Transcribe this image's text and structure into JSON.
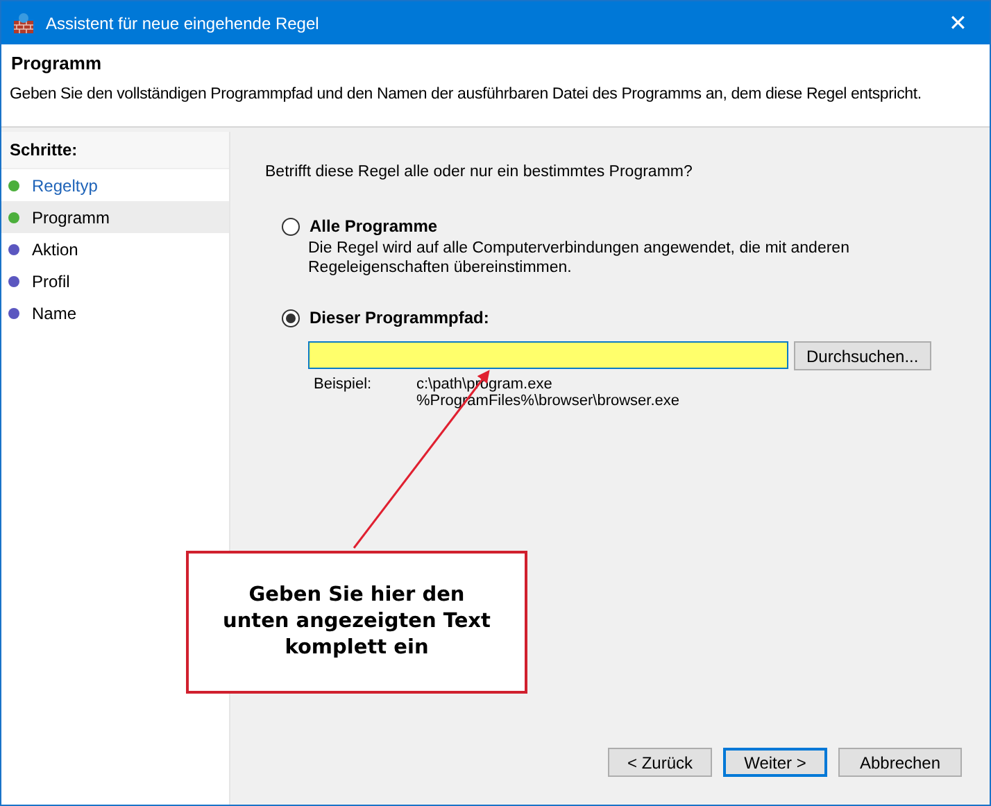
{
  "window": {
    "title": "Assistent für neue eingehende Regel",
    "close": "✕"
  },
  "header": {
    "title": "Programm",
    "description": "Geben Sie den vollständigen Programmpfad und den Namen der ausführbaren Datei des Programms an, dem diese Regel entspricht."
  },
  "steps": {
    "title": "Schritte:",
    "items": [
      {
        "label": "Regeltyp",
        "color": "#4caf3c",
        "selected": false,
        "link": true
      },
      {
        "label": "Programm",
        "color": "#4caf3c",
        "selected": true,
        "link": false
      },
      {
        "label": "Aktion",
        "color": "#5b57c0",
        "selected": false,
        "link": false
      },
      {
        "label": "Profil",
        "color": "#5b57c0",
        "selected": false,
        "link": false
      },
      {
        "label": "Name",
        "color": "#5b57c0",
        "selected": false,
        "link": false
      }
    ]
  },
  "question": "Betrifft diese Regel alle oder nur ein bestimmtes Programm?",
  "options": [
    {
      "label": "Alle Programme",
      "selected": false,
      "description": "Die Regel wird auf alle Computerverbindungen angewendet, die mit anderen Regeleigenschaften übereinstimmen."
    },
    {
      "label": "Dieser Programmpfad:",
      "selected": true
    }
  ],
  "path_field": {
    "browse_button": "Durchsuchen...",
    "example_label": "Beispiel:",
    "examples": [
      "c:\\path\\program.exe",
      "%ProgramFiles%\\browser\\browser.exe"
    ]
  },
  "callout": "Geben Sie hier den unten angezeigten Text komplett ein",
  "buttons": [
    {
      "label": "< Zurück",
      "default": false
    },
    {
      "label": "Weiter >",
      "default": true
    },
    {
      "label": "Abbrechen",
      "default": false
    }
  ]
}
